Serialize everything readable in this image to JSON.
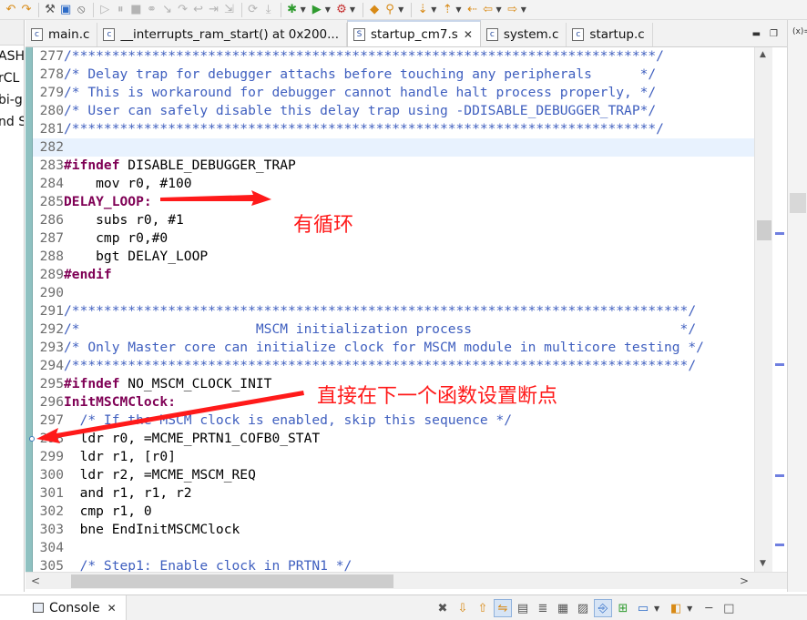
{
  "toolbar": {
    "buttons": [
      {
        "name": "back-icon",
        "glyph": "↶"
      },
      {
        "name": "redo-icon",
        "glyph": "↷"
      },
      {
        "name": "build-icon",
        "glyph": "⚒"
      },
      {
        "name": "save-icon",
        "glyph": "▣"
      },
      {
        "name": "skip-breakpoints-icon",
        "glyph": "⦸"
      },
      {
        "name": "resume-icon",
        "glyph": "▷"
      },
      {
        "name": "suspend-icon",
        "glyph": "⏸"
      },
      {
        "name": "terminate-icon",
        "glyph": "■"
      },
      {
        "name": "disconnect-icon",
        "glyph": "⚭"
      },
      {
        "name": "step-into-icon",
        "glyph": "↘"
      },
      {
        "name": "step-over-icon",
        "glyph": "↷"
      },
      {
        "name": "step-return-icon",
        "glyph": "↩"
      },
      {
        "name": "instruction-step-icon",
        "glyph": "⇥"
      },
      {
        "name": "use-step-filters-icon",
        "glyph": "⇲"
      },
      {
        "name": "restart-icon",
        "glyph": "⟳"
      },
      {
        "name": "drop-to-frame-icon",
        "glyph": "⤓"
      },
      {
        "name": "debug-icon",
        "glyph": "✱"
      },
      {
        "name": "run-icon",
        "glyph": "▶"
      },
      {
        "name": "external-tools-icon",
        "glyph": "⚙"
      },
      {
        "name": "open-type-icon",
        "glyph": "◆"
      },
      {
        "name": "search-icon",
        "glyph": "⚲"
      },
      {
        "name": "next-annotation-icon",
        "glyph": "⇣"
      },
      {
        "name": "previous-annotation-icon",
        "glyph": "⇡"
      },
      {
        "name": "last-edit-icon",
        "glyph": "⇠"
      },
      {
        "name": "back-nav-icon",
        "glyph": "⇦"
      },
      {
        "name": "forward-nav-icon",
        "glyph": "⇨"
      }
    ]
  },
  "left_pane": {
    "fragments": [
      "ASH",
      "rCL",
      "bi-g",
      "nd S"
    ]
  },
  "right_pane": {
    "label": "(x)="
  },
  "tabs": [
    {
      "icon": "c",
      "label": "main.c",
      "close": "",
      "active": false
    },
    {
      "icon": "c",
      "label": "__interrupts_ram_start() at 0x200...",
      "close": "",
      "active": false
    },
    {
      "icon": "S",
      "label": "startup_cm7.s",
      "close": "✕",
      "active": true
    },
    {
      "icon": "c",
      "label": "system.c",
      "close": "",
      "active": false
    },
    {
      "icon": "c",
      "label": "startup.c",
      "close": "",
      "active": false
    }
  ],
  "editor": {
    "lines": [
      {
        "n": "277",
        "parts": [
          {
            "t": "/*************************************************************************/",
            "c": "cm"
          }
        ]
      },
      {
        "n": "278",
        "parts": [
          {
            "t": "/* Delay trap for debugger attachs before touching any peripherals      */",
            "c": "cm"
          }
        ]
      },
      {
        "n": "279",
        "parts": [
          {
            "t": "/* This is workaround for debugger cannot handle halt process properly, */",
            "c": "cm"
          }
        ]
      },
      {
        "n": "280",
        "parts": [
          {
            "t": "/* User can safely disable this delay trap using -DDISABLE_DEBUGGER_TRAP*/",
            "c": "cm"
          }
        ]
      },
      {
        "n": "281",
        "parts": [
          {
            "t": "/*************************************************************************/",
            "c": "cm"
          }
        ]
      },
      {
        "n": "282",
        "parts": [
          {
            "t": "",
            "c": "tx"
          }
        ],
        "current": true
      },
      {
        "n": "283",
        "parts": [
          {
            "t": "#ifndef",
            "c": "kw"
          },
          {
            "t": " DISABLE_DEBUGGER_TRAP",
            "c": "tx"
          }
        ]
      },
      {
        "n": "284",
        "parts": [
          {
            "t": "    mov r0, #100",
            "c": "tx"
          }
        ]
      },
      {
        "n": "285",
        "parts": [
          {
            "t": "DELAY_LOOP:",
            "c": "kw"
          }
        ]
      },
      {
        "n": "286",
        "parts": [
          {
            "t": "    subs r0, #1",
            "c": "tx"
          }
        ]
      },
      {
        "n": "287",
        "parts": [
          {
            "t": "    cmp r0,#0",
            "c": "tx"
          }
        ]
      },
      {
        "n": "288",
        "parts": [
          {
            "t": "    bgt DELAY_LOOP",
            "c": "tx"
          }
        ]
      },
      {
        "n": "289",
        "parts": [
          {
            "t": "#endif",
            "c": "kw"
          }
        ]
      },
      {
        "n": "290",
        "parts": [
          {
            "t": "",
            "c": "tx"
          }
        ]
      },
      {
        "n": "291",
        "parts": [
          {
            "t": "/*****************************************************************************/",
            "c": "cm"
          }
        ]
      },
      {
        "n": "292",
        "parts": [
          {
            "t": "/*                      MSCM initialization process                          */",
            "c": "cm"
          }
        ]
      },
      {
        "n": "293",
        "parts": [
          {
            "t": "/* Only Master core can initialize clock for MSCM module in multicore testing */",
            "c": "cm"
          }
        ]
      },
      {
        "n": "294",
        "parts": [
          {
            "t": "/*****************************************************************************/",
            "c": "cm"
          }
        ]
      },
      {
        "n": "295",
        "parts": [
          {
            "t": "#ifndef",
            "c": "kw"
          },
          {
            "t": " NO_MSCM_CLOCK_INIT",
            "c": "tx"
          }
        ]
      },
      {
        "n": "296",
        "parts": [
          {
            "t": "InitMSCMClock:",
            "c": "kw"
          }
        ]
      },
      {
        "n": "297",
        "parts": [
          {
            "t": "  /* If the MSCM clock is enabled, skip this sequence */",
            "c": "cm"
          }
        ]
      },
      {
        "n": "298",
        "parts": [
          {
            "t": "  ldr r0, =MCME_PRTN1_COFB0_STAT",
            "c": "tx"
          }
        ],
        "breakpoint": true
      },
      {
        "n": "299",
        "parts": [
          {
            "t": "  ldr r1, [r0]",
            "c": "tx"
          }
        ]
      },
      {
        "n": "300",
        "parts": [
          {
            "t": "  ldr r2, =MCME_MSCM_REQ",
            "c": "tx"
          }
        ]
      },
      {
        "n": "301",
        "parts": [
          {
            "t": "  and r1, r1, r2",
            "c": "tx"
          }
        ]
      },
      {
        "n": "302",
        "parts": [
          {
            "t": "  cmp r1, 0",
            "c": "tx"
          }
        ]
      },
      {
        "n": "303",
        "parts": [
          {
            "t": "  bne EndInitMSCMClock",
            "c": "tx"
          }
        ]
      },
      {
        "n": "304",
        "parts": [
          {
            "t": "",
            "c": "tx"
          }
        ]
      },
      {
        "n": "305",
        "parts": [
          {
            "t": "  /* Step1: Enable clock in PRTN1 */",
            "c": "cm"
          }
        ]
      }
    ]
  },
  "scrollbars": {
    "vertical_up": "▲",
    "vertical_down": "▼",
    "horizontal_left": "<",
    "horizontal_right": ">"
  },
  "console": {
    "label": "Console",
    "close": "✕",
    "tools": [
      {
        "name": "terminate-icon",
        "glyph": "✖",
        "cls": ""
      },
      {
        "name": "scroll-down-icon",
        "glyph": "⇩",
        "cls": "orange"
      },
      {
        "name": "scroll-up-icon",
        "glyph": "⇧",
        "cls": "orange"
      },
      {
        "name": "scroll-lock-icon",
        "glyph": "⇋",
        "cls": "orange on"
      },
      {
        "name": "clear-console-icon",
        "glyph": "▤",
        "cls": ""
      },
      {
        "name": "word-wrap-icon",
        "glyph": "≣",
        "cls": ""
      },
      {
        "name": "show-on-output-icon",
        "glyph": "▦",
        "cls": ""
      },
      {
        "name": "show-on-error-icon",
        "glyph": "▨",
        "cls": ""
      },
      {
        "name": "pin-console-icon",
        "glyph": "⎆",
        "cls": "blue on"
      },
      {
        "name": "new-console-icon",
        "glyph": "⊞",
        "cls": "green"
      },
      {
        "name": "display-console-icon",
        "glyph": "▭",
        "cls": "blue"
      },
      {
        "name": "open-console-icon",
        "glyph": "◧",
        "cls": "orange"
      },
      {
        "name": "minimize-icon",
        "glyph": "─",
        "cls": ""
      },
      {
        "name": "maximize-icon",
        "glyph": "□",
        "cls": ""
      }
    ]
  },
  "annotations": {
    "loop_note": "有循环",
    "breakpoint_note": "直接在下一个函数设置断点",
    "color": "#ff1a1a"
  }
}
